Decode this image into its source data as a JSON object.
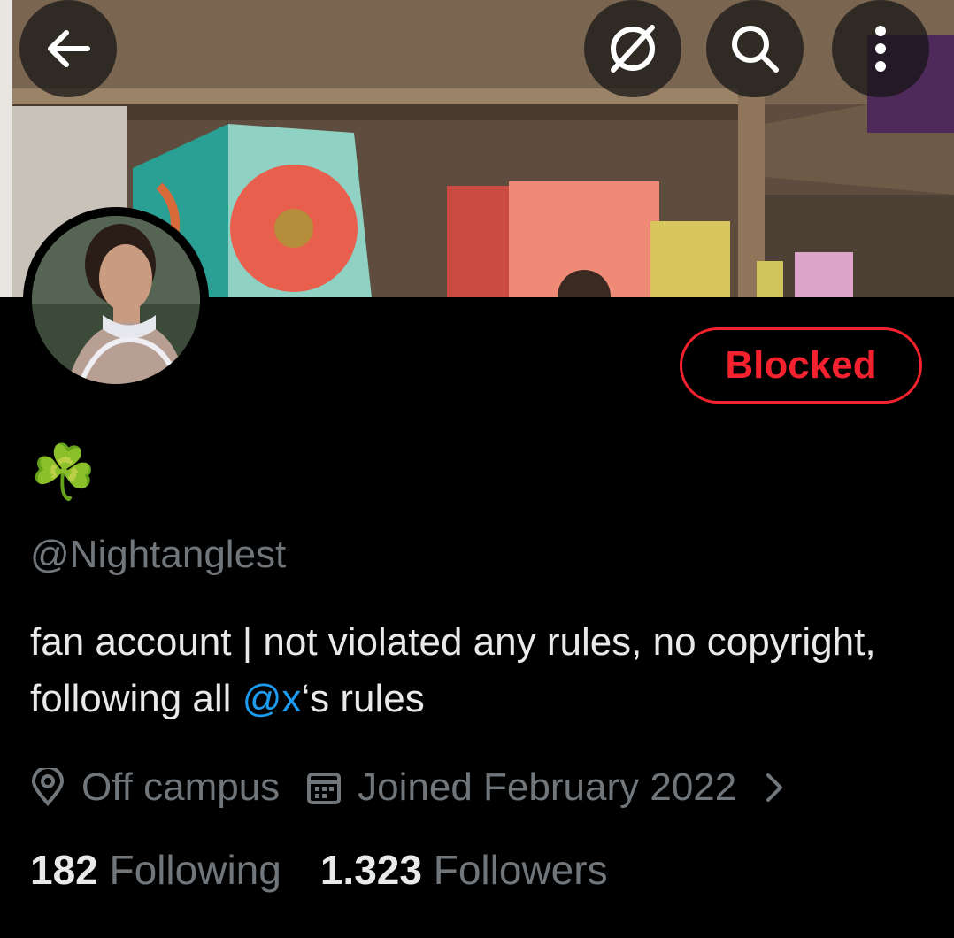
{
  "header": {
    "back_icon": "arrow-left-icon",
    "grok_icon": "grok-icon",
    "search_icon": "search-icon",
    "more_icon": "more-vertical-icon"
  },
  "profile": {
    "display_name": "☘️",
    "handle": "@Nightanglest",
    "bio_part1": "fan account | not violated any rules, no copyright, following all ",
    "bio_mention": "@x",
    "bio_part2": "‘s rules",
    "location": "Off campus",
    "joined": "Joined February 2022",
    "following_count": "182",
    "following_label": "Following",
    "followers_count": "1.323",
    "followers_label": "Followers"
  },
  "actions": {
    "blocked_label": "Blocked"
  },
  "colors": {
    "background": "#000000",
    "text_primary": "#e7e9ea",
    "text_secondary": "#71767b",
    "blocked_red": "#f4212e",
    "link_blue": "#1d9bf0"
  }
}
